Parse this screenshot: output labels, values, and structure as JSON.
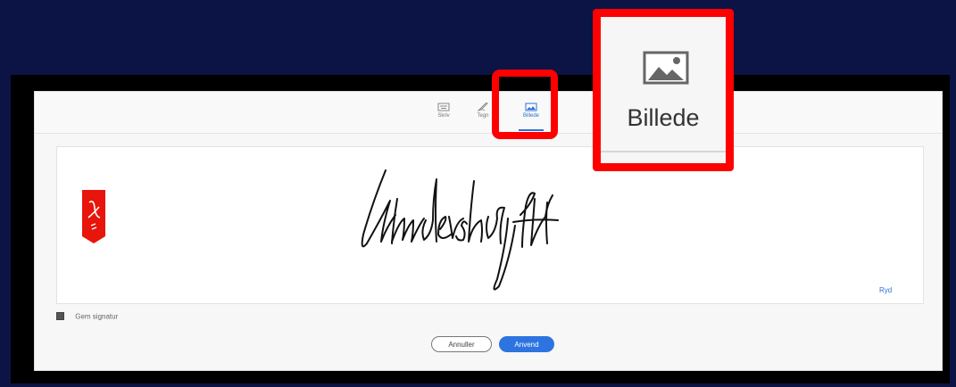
{
  "tabs": [
    {
      "label": "Skriv",
      "icon": "keyboard-icon",
      "active": false
    },
    {
      "label": "Tegn",
      "icon": "draw-pen-icon",
      "active": false
    },
    {
      "label": "Billede",
      "icon": "image-icon",
      "active": true
    }
  ],
  "signature": {
    "clear_label": "Ryd",
    "logo": "adobe-acrobat-icon"
  },
  "save_option": {
    "label": "Gem signatur",
    "checked": true
  },
  "buttons": {
    "cancel_label": "Annuller",
    "apply_label": "Anvend"
  },
  "zoom_callout": {
    "label": "Billede",
    "icon": "image-icon"
  },
  "colors": {
    "background": "#0b1445",
    "highlight": "#ff0000",
    "accent": "#2d74e0",
    "logo_red": "#e8150c"
  }
}
